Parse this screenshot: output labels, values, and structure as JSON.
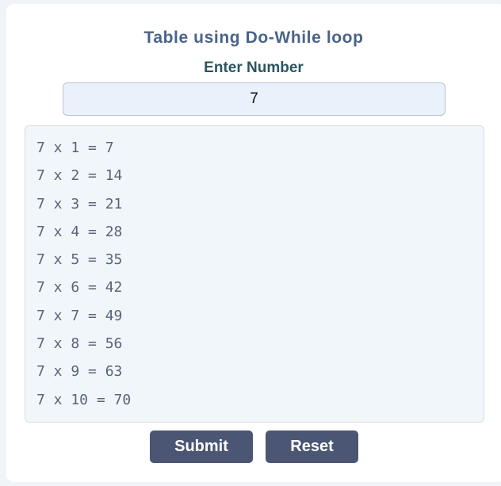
{
  "page": {
    "title": "Table using Do-While loop",
    "input_label": "Enter Number"
  },
  "input": {
    "value": "7"
  },
  "table": {
    "lines": [
      "7 x 1 = 7",
      "7 x 2 = 14",
      "7 x 3 = 21",
      "7 x 4 = 28",
      "7 x 5 = 35",
      "7 x 6 = 42",
      "7 x 7 = 49",
      "7 x 8 = 56",
      "7 x 9 = 63",
      "7 x 10 = 70"
    ]
  },
  "buttons": {
    "submit_label": "Submit",
    "reset_label": "Reset"
  },
  "colors": {
    "title": "#4a6389",
    "label": "#2c5560",
    "button_bg": "#4a5673",
    "output_text": "#5a6478"
  }
}
